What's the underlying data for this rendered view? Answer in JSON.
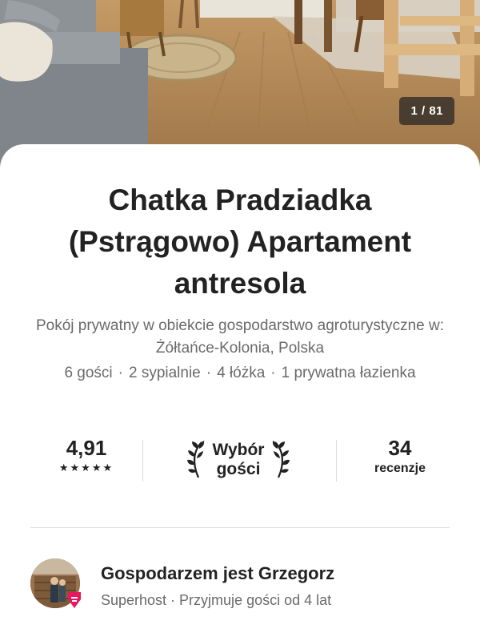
{
  "gallery": {
    "counter": "1 / 81"
  },
  "listing": {
    "title": "Chatka Pradziadka (Pstrągowo) Apartament antresola",
    "subtitle": "Pokój prywatny w obiekcie gospodarstwo agroturystyczne w: Żółtańce-Kolonia, Polska",
    "details": {
      "guests": "6 gości",
      "bedrooms": "2 sypialnie",
      "beds": "4 łóżka",
      "baths": "1 prywatna łazienka",
      "separator": "·"
    }
  },
  "stats": {
    "rating": "4,91",
    "stars": "★★★★★",
    "guest_choice": {
      "line1": "Wybór",
      "line2": "gości"
    },
    "reviews": {
      "count": "34",
      "label": "recenzje"
    }
  },
  "host": {
    "name": "Gospodarzem jest Grzegorz",
    "subtitle": "Superhost · Przyjmuje gości od 4 lat"
  },
  "colors": {
    "text_primary": "#222222",
    "text_secondary": "#6a6a6a",
    "divider": "#dddddd",
    "superhost_badge": "#e6195f"
  }
}
